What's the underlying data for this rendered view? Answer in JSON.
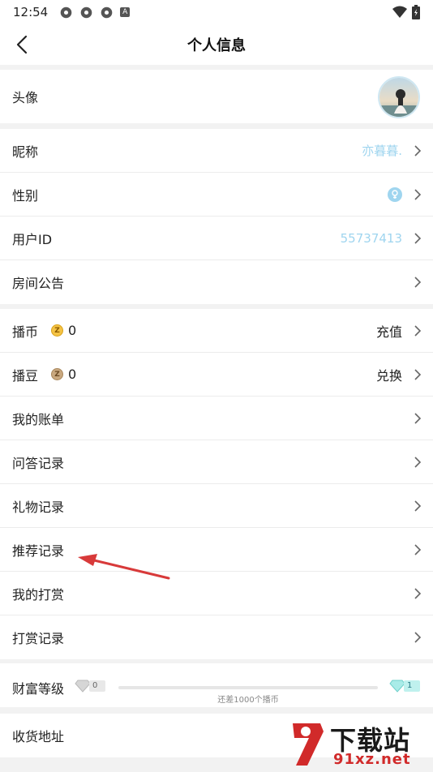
{
  "status": {
    "time": "12:54",
    "badge": "A"
  },
  "nav": {
    "title": "个人信息"
  },
  "profile": {
    "avatar_label": "头像",
    "rows": [
      {
        "label": "昵称",
        "value": "亦暮暮."
      },
      {
        "label": "性别",
        "value": ""
      },
      {
        "label": "用户ID",
        "value": "55737413"
      },
      {
        "label": "房间公告",
        "value": ""
      }
    ]
  },
  "wallet": {
    "rows": [
      {
        "label": "播币",
        "coin": "Z",
        "amount": "0",
        "action": "充值"
      },
      {
        "label": "播豆",
        "coin": "Z",
        "amount": "0",
        "action": "兑换"
      }
    ],
    "records": [
      "我的账单",
      "问答记录",
      "礼物记录",
      "推荐记录",
      "我的打赏",
      "打赏记录"
    ]
  },
  "wealth": {
    "label": "财富等级",
    "current_level": "0",
    "next_level": "1",
    "progress": 0,
    "hint": "还差1000个播币"
  },
  "address": {
    "label": "收货地址"
  },
  "watermark": {
    "line1": "下载站",
    "line2": "91xz.net"
  },
  "colors": {
    "accent": "#9fd5ef",
    "arrow": "#d83a3a",
    "gold": "#f5c344"
  }
}
